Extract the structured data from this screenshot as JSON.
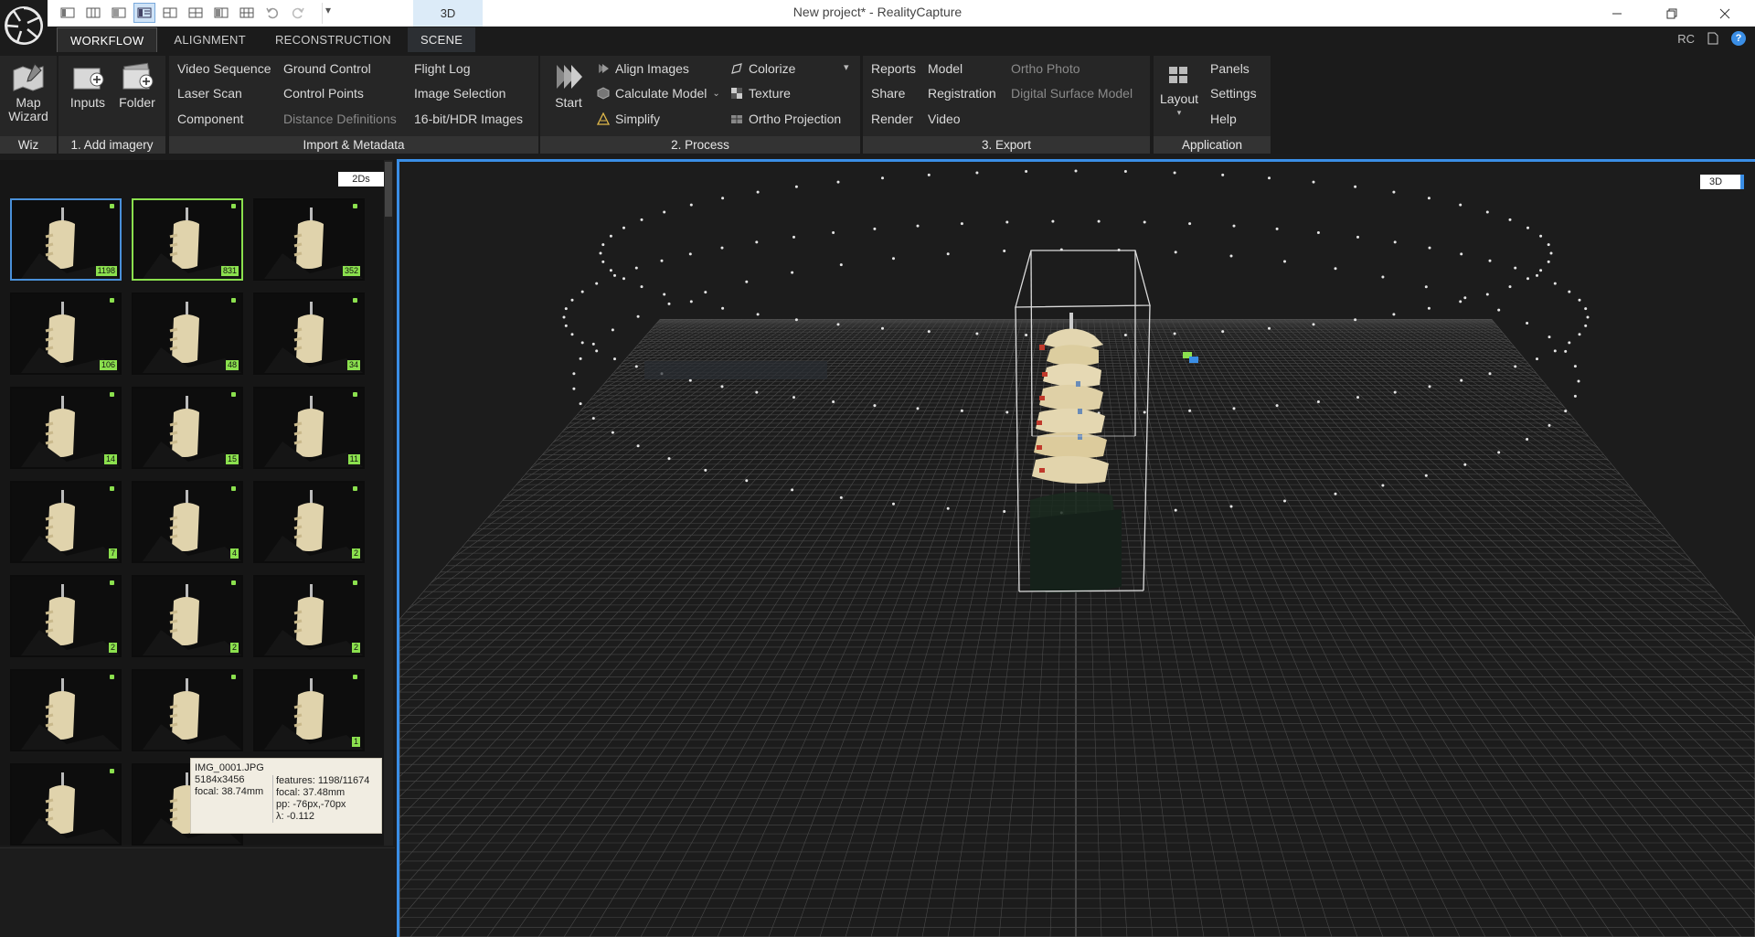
{
  "window": {
    "title": "New project* - RealityCapture",
    "context_tab_label": "3D",
    "qat_dropdown": "▾"
  },
  "ribbon": {
    "tabs": [
      {
        "label": "WORKFLOW"
      },
      {
        "label": "ALIGNMENT"
      },
      {
        "label": "RECONSTRUCTION"
      },
      {
        "label": "SCENE"
      }
    ],
    "corner": {
      "rc": "RC",
      "help": "?"
    },
    "groups": {
      "wiz": {
        "label": "Wiz",
        "map_wizard": "Map Wizard"
      },
      "add": {
        "label": "1. Add imagery",
        "inputs": "Inputs",
        "folder": "Folder"
      },
      "import": {
        "label": "Import & Metadata",
        "items": [
          "Video Sequence",
          "Ground Control",
          "Flight Log",
          "Laser Scan",
          "Control Points",
          "Image Selection",
          "Component",
          "Distance Definitions",
          "16-bit/HDR Images"
        ]
      },
      "process": {
        "label": "2. Process",
        "start": "Start",
        "align": "Align Images",
        "calc": "Calculate Model",
        "simplify": "Simplify",
        "colorize": "Colorize",
        "texture": "Texture",
        "ortho": "Ortho Projection"
      },
      "export": {
        "label": "3. Export",
        "items": [
          "Reports",
          "Model",
          "Ortho Photo",
          "Share",
          "Registration",
          "Digital Surface Model",
          "Render",
          "Video"
        ]
      },
      "application": {
        "label": "Application",
        "layout": "Layout",
        "panels": "Panels",
        "settings": "Settings",
        "help": "Help"
      }
    }
  },
  "images_panel": {
    "view_label": "2Ds",
    "thumbnails": [
      {
        "count": "1198",
        "state": "selected-blue"
      },
      {
        "count": "831",
        "state": "selected-green"
      },
      {
        "count": "352",
        "state": "normal"
      },
      {
        "count": "106",
        "state": "normal"
      },
      {
        "count": "48",
        "state": "normal"
      },
      {
        "count": "34",
        "state": "normal"
      },
      {
        "count": "14",
        "state": "normal"
      },
      {
        "count": "15",
        "state": "normal"
      },
      {
        "count": "11",
        "state": "normal"
      },
      {
        "count": "7",
        "state": "normal"
      },
      {
        "count": "4",
        "state": "normal"
      },
      {
        "count": "2",
        "state": "normal"
      },
      {
        "count": "2",
        "state": "normal"
      },
      {
        "count": "2",
        "state": "normal"
      },
      {
        "count": "2",
        "state": "normal"
      },
      {
        "count": "",
        "state": "normal"
      },
      {
        "count": "",
        "state": "normal"
      },
      {
        "count": "1",
        "state": "normal"
      },
      {
        "count": "",
        "state": "normal"
      },
      {
        "count": "",
        "state": "normal"
      }
    ]
  },
  "tooltip": {
    "filename": "IMG_0001.JPG",
    "resolution": "5184x3456",
    "focal_prior": "focal: 38.74mm",
    "features": "features: 1198/11674",
    "focal": "focal: 37.48mm",
    "pp": "pp: -76px,-70px",
    "lambda": "λ: -0.112"
  },
  "view3d": {
    "label": "3D"
  }
}
